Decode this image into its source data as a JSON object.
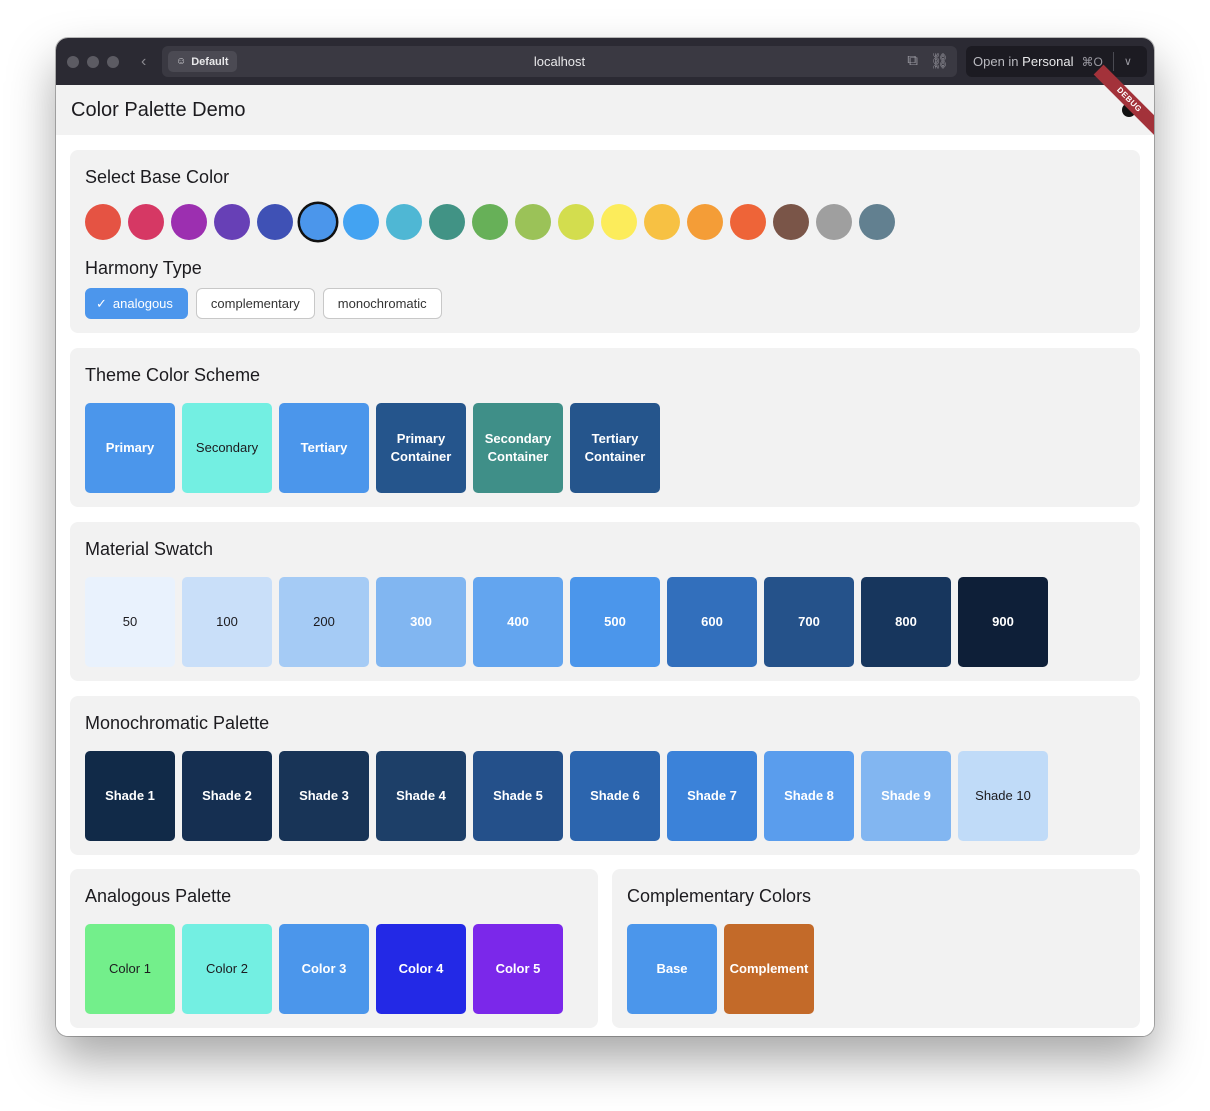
{
  "browser": {
    "profile": "Default",
    "url": "localhost",
    "open_in_prefix": "Open in",
    "open_in_target": "Personal",
    "shortcut": "⌘O"
  },
  "app": {
    "title": "Color Palette Demo",
    "debug_banner": "DEBUG"
  },
  "base_color": {
    "heading": "Select Base Color",
    "colors": [
      "#e55343",
      "#d63864",
      "#9c2fb0",
      "#6740b6",
      "#3f51b5",
      "#4b96eb",
      "#43a3f2",
      "#4fb7d4",
      "#419385",
      "#67b058",
      "#9bc258",
      "#d3dd4e",
      "#fcec5b",
      "#f7c143",
      "#f49d37",
      "#ee6438",
      "#7a5548",
      "#9f9f9f",
      "#628090"
    ],
    "selected_index": 5
  },
  "harmony": {
    "heading": "Harmony Type",
    "options": [
      "analogous",
      "complementary",
      "monochromatic"
    ],
    "selected": "analogous"
  },
  "theme_scheme": {
    "heading": "Theme Color Scheme",
    "tiles": [
      {
        "label": "Primary",
        "color": "#4b96eb",
        "text": "light"
      },
      {
        "label": "Secondary",
        "color": "#73efe2",
        "text": "dark"
      },
      {
        "label": "Tertiary",
        "color": "#4b96eb",
        "text": "light"
      },
      {
        "label": "Primary Container",
        "color": "#25558c",
        "text": "light"
      },
      {
        "label": "Secondary Container",
        "color": "#3f8f88",
        "text": "light"
      },
      {
        "label": "Tertiary Container",
        "color": "#25558c",
        "text": "light"
      }
    ]
  },
  "material_swatch": {
    "heading": "Material Swatch",
    "tiles": [
      {
        "label": "50",
        "color": "#e9f2fd",
        "text": "dark"
      },
      {
        "label": "100",
        "color": "#c9dff9",
        "text": "dark"
      },
      {
        "label": "200",
        "color": "#a5cbf5",
        "text": "dark"
      },
      {
        "label": "300",
        "color": "#81b6f1",
        "text": "light"
      },
      {
        "label": "400",
        "color": "#63a5ef",
        "text": "light"
      },
      {
        "label": "500",
        "color": "#4b96eb",
        "text": "light"
      },
      {
        "label": "600",
        "color": "#326fbc",
        "text": "light"
      },
      {
        "label": "700",
        "color": "#25528a",
        "text": "light"
      },
      {
        "label": "800",
        "color": "#17365d",
        "text": "light"
      },
      {
        "label": "900",
        "color": "#0e1f38",
        "text": "light"
      }
    ]
  },
  "monochromatic": {
    "heading": "Monochromatic Palette",
    "tiles": [
      {
        "label": "Shade 1",
        "color": "#112a48",
        "text": "light"
      },
      {
        "label": "Shade 2",
        "color": "#152f51",
        "text": "light"
      },
      {
        "label": "Shade 3",
        "color": "#183457",
        "text": "light"
      },
      {
        "label": "Shade 4",
        "color": "#1d3f68",
        "text": "light"
      },
      {
        "label": "Shade 5",
        "color": "#24508a",
        "text": "light"
      },
      {
        "label": "Shade 6",
        "color": "#2c65ae",
        "text": "light"
      },
      {
        "label": "Shade 7",
        "color": "#3b82d9",
        "text": "light"
      },
      {
        "label": "Shade 8",
        "color": "#5a9ded",
        "text": "light"
      },
      {
        "label": "Shade 9",
        "color": "#82b6f1",
        "text": "light"
      },
      {
        "label": "Shade 10",
        "color": "#c0dbf8",
        "text": "dark"
      }
    ]
  },
  "analogous": {
    "heading": "Analogous Palette",
    "tiles": [
      {
        "label": "Color 1",
        "color": "#73ef8b",
        "text": "dark"
      },
      {
        "label": "Color 2",
        "color": "#73efe2",
        "text": "dark"
      },
      {
        "label": "Color 3",
        "color": "#4b96eb",
        "text": "light"
      },
      {
        "label": "Color 4",
        "color": "#2329e6",
        "text": "light"
      },
      {
        "label": "Color 5",
        "color": "#7b28ea",
        "text": "light"
      }
    ]
  },
  "complementary": {
    "heading": "Complementary Colors",
    "tiles": [
      {
        "label": "Base",
        "color": "#4b96eb",
        "text": "light"
      },
      {
        "label": "Complement",
        "color": "#c36a29",
        "text": "light"
      }
    ]
  }
}
